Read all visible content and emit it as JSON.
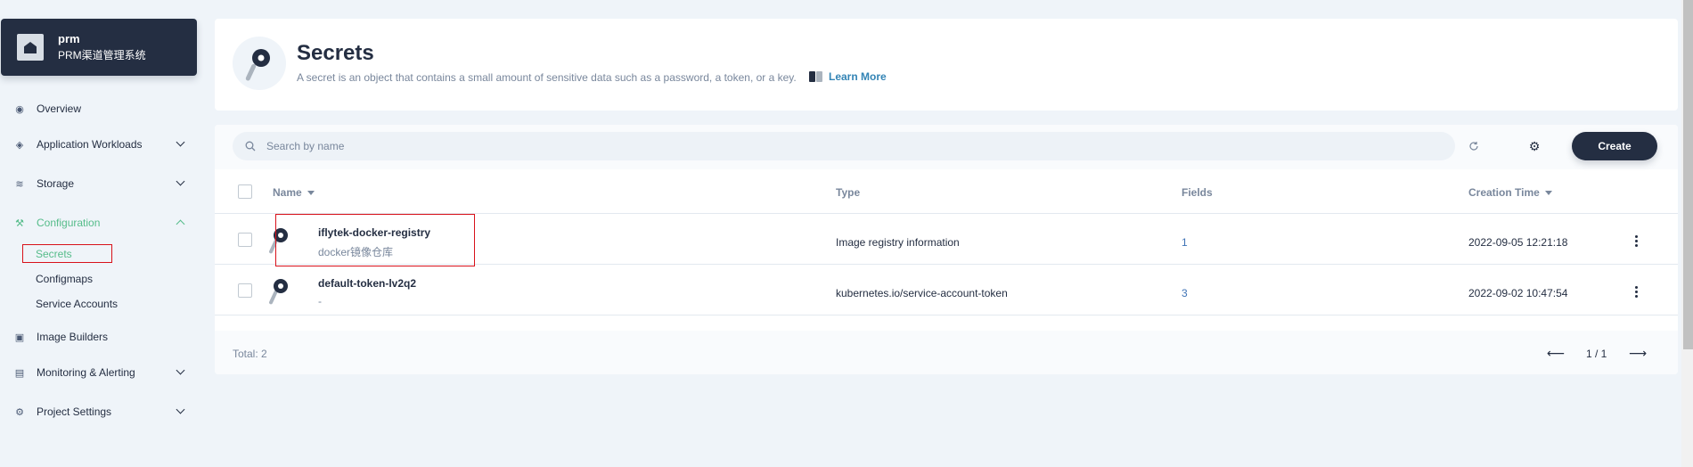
{
  "project": {
    "name": "prm",
    "subtitle": "PRM渠道管理系统"
  },
  "nav": {
    "overview": "Overview",
    "workloads": "Application Workloads",
    "storage": "Storage",
    "configuration": "Configuration",
    "secrets": "Secrets",
    "configmaps": "Configmaps",
    "service_accounts": "Service Accounts",
    "image_builders": "Image Builders",
    "monitoring": "Monitoring & Alerting",
    "project_settings": "Project Settings"
  },
  "header": {
    "title": "Secrets",
    "description": "A secret is an object that contains a small amount of sensitive data such as a password, a token, or a key.",
    "learn_more": "Learn More"
  },
  "toolbar": {
    "search_placeholder": "Search by name",
    "create_label": "Create"
  },
  "table": {
    "columns": {
      "name": "Name",
      "type": "Type",
      "fields": "Fields",
      "creation_time": "Creation Time"
    },
    "rows": [
      {
        "name": "iflytek-docker-registry",
        "desc": "docker镜像仓库",
        "type": "Image registry information",
        "fields": "1",
        "created": "2022-09-05 12:21:18"
      },
      {
        "name": "default-token-lv2q2",
        "desc": "-",
        "type": "kubernetes.io/service-account-token",
        "fields": "3",
        "created": "2022-09-02 10:47:54"
      }
    ]
  },
  "footer": {
    "total": "Total: 2",
    "page": "1 / 1"
  },
  "colors": {
    "accent": "#55bc8a",
    "dark": "#242e42",
    "highlight_box": "#d8111a"
  }
}
